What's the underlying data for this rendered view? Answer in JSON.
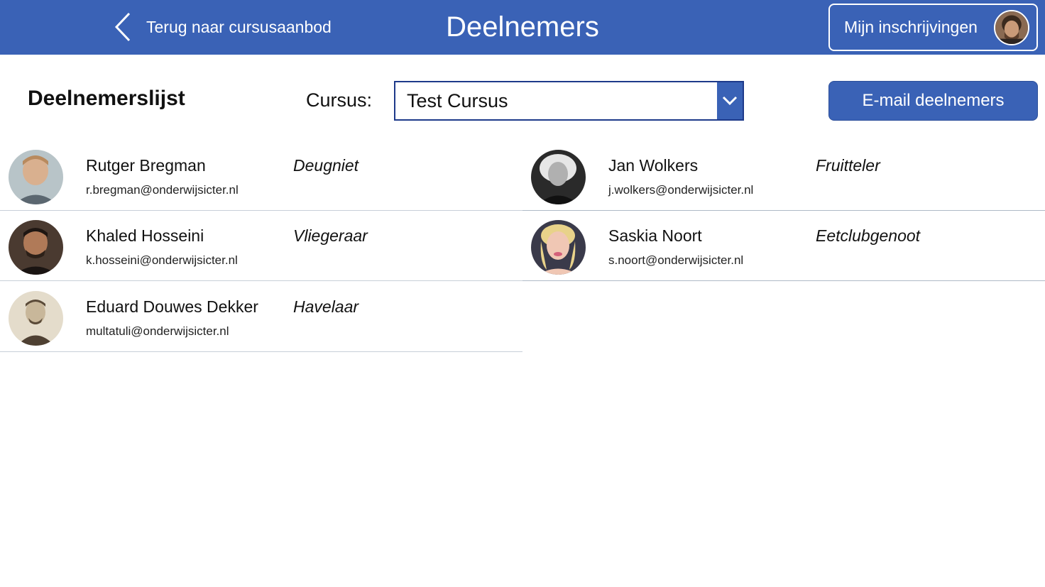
{
  "header": {
    "back_label": "Terug naar cursusaanbod",
    "title": "Deelnemers",
    "my_registrations_label": "Mijn inschrijvingen",
    "bg_color": "#3a62b6"
  },
  "toolbar": {
    "list_title": "Deelnemerslijst",
    "course_label": "Cursus:",
    "course_selected": "Test Cursus",
    "email_button_label": "E-mail deelnemers"
  },
  "participants": [
    {
      "name": "Rutger Bregman",
      "email": "r.bregman@onderwijsicter.nl",
      "role": "Deugniet"
    },
    {
      "name": "Jan Wolkers",
      "email": "j.wolkers@onderwijsicter.nl",
      "role": "Fruitteler"
    },
    {
      "name": "Khaled Hosseini",
      "email": "k.hosseini@onderwijsicter.nl",
      "role": "Vliegeraar"
    },
    {
      "name": "Saskia Noort",
      "email": "s.noort@onderwijsicter.nl",
      "role": "Eetclubgenoot"
    },
    {
      "name": "Eduard Douwes Dekker",
      "email": "multatuli@onderwijsicter.nl",
      "role": "Havelaar"
    }
  ],
  "icons": {
    "back": "chevron-left-icon",
    "dropdown": "chevron-down-icon",
    "avatar": "user-avatar"
  }
}
